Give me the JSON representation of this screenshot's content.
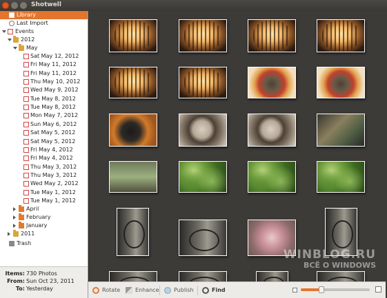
{
  "window": {
    "title": "Shotwell"
  },
  "sidebar": {
    "library": "Library",
    "last_import": "Last Import",
    "events": "Events",
    "year_2012": "2012",
    "month_may": "May",
    "days": [
      "Sat May 12, 2012",
      "Fri May 11, 2012",
      "Fri May 11, 2012",
      "Thu May 10, 2012",
      "Wed May 9, 2012",
      "Tue May 8, 2012",
      "Tue May 8, 2012",
      "Mon May 7, 2012",
      "Sun May 6, 2012",
      "Sat May 5, 2012",
      "Sat May 5, 2012",
      "Fri May 4, 2012",
      "Fri May 4, 2012",
      "Thu May 3, 2012",
      "Thu May 3, 2012",
      "Wed May 2, 2012",
      "Tue May 1, 2012",
      "Tue May 1, 2012"
    ],
    "month_april": "April",
    "month_february": "February",
    "month_january": "January",
    "year_2011": "2011",
    "trash": "Trash"
  },
  "info": {
    "items_label": "Items:",
    "items_value": "730 Photos",
    "from_label": "From:",
    "from_value": "Sun Oct 23, 2011",
    "to_label": "To:",
    "to_value": "Yesterday"
  },
  "toolbar": {
    "rotate": "Rotate",
    "enhance": "Enhance",
    "publish": "Publish",
    "find": "Find",
    "zoom_level": 0.3
  },
  "watermark": {
    "line1": "WINBLOG.RU",
    "line2": "ВСЁ О WINDOWS"
  },
  "icons": [
    "library-icon",
    "clock-icon",
    "events-icon",
    "folder-icon",
    "trash-icon",
    "rotate-icon",
    "enhance-icon",
    "publish-icon",
    "find-icon",
    "zoom-out-icon",
    "zoom-in-icon"
  ],
  "colors": {
    "accent": "#e3752d",
    "viewer_bg": "#3d3b38"
  }
}
